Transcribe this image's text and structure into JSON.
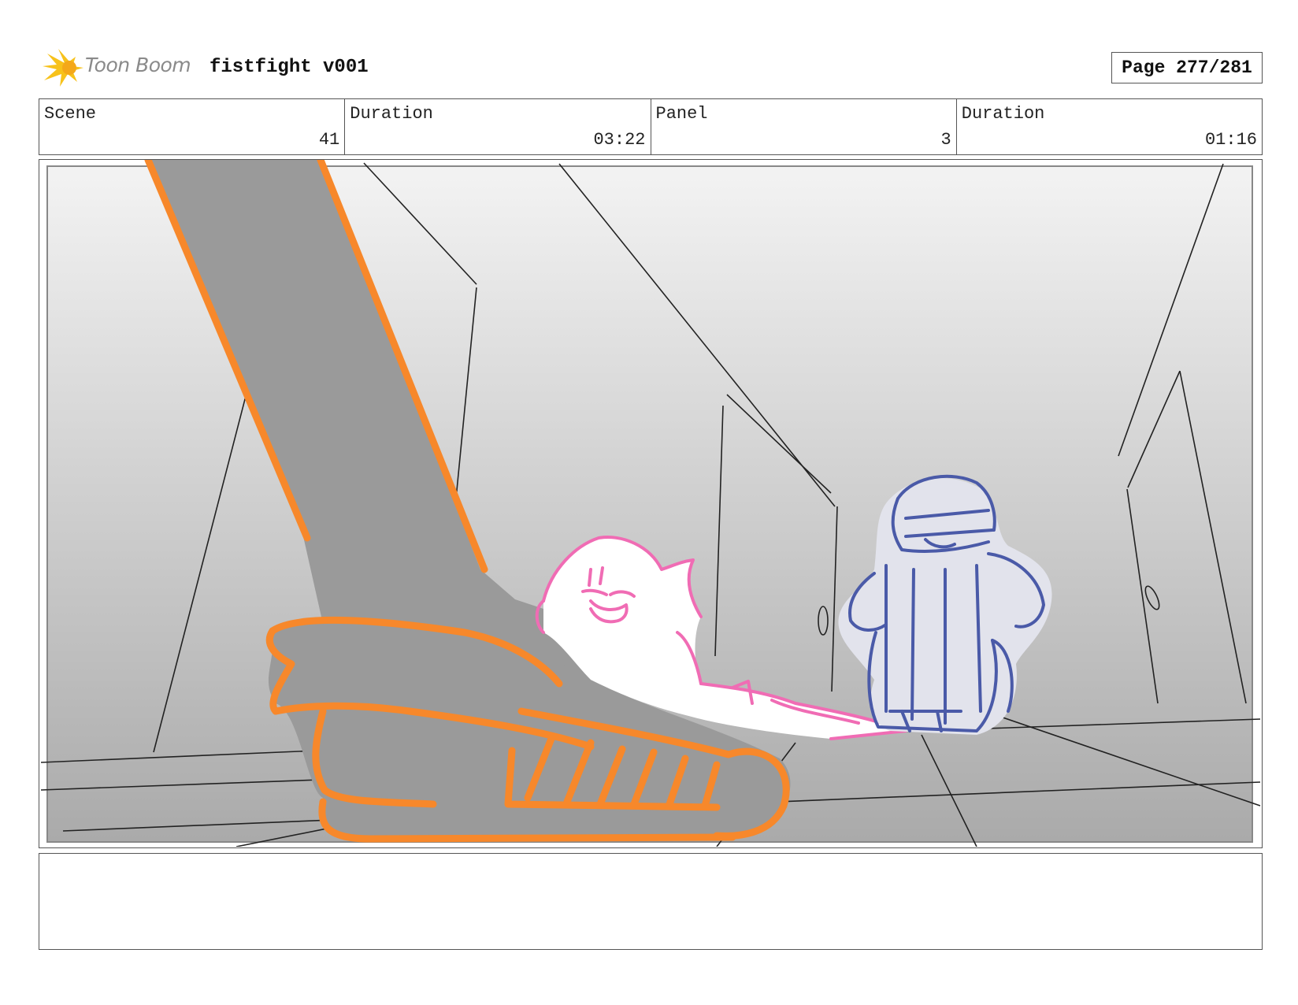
{
  "header": {
    "logo_text": "Toon Boom",
    "project_title": "fistfight v001",
    "page_label": "Page 277/281"
  },
  "info": [
    {
      "label": "Scene",
      "value": "41"
    },
    {
      "label": "Duration",
      "value": "03:22"
    },
    {
      "label": "Panel",
      "value": "3"
    },
    {
      "label": "Duration",
      "value": "01:16"
    }
  ],
  "panel": {
    "colors": {
      "boot_outline": "#f7882b",
      "boot_fill": "#999999",
      "pink_character": "#f06cb4",
      "blue_character": "#4a5aa8"
    }
  },
  "notes": {
    "text": ""
  }
}
